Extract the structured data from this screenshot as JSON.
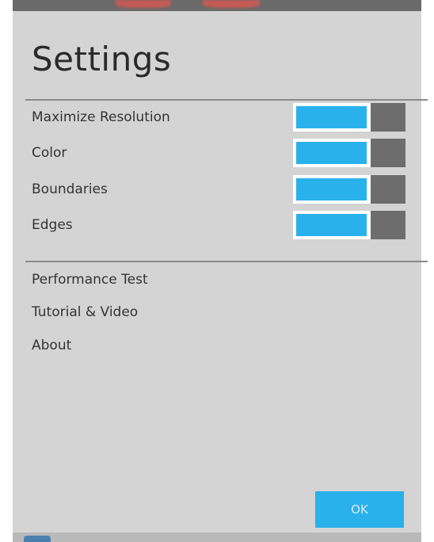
{
  "dialog": {
    "title": "Settings"
  },
  "toggles": [
    {
      "label": "Maximize Resolution",
      "on": true
    },
    {
      "label": "Color",
      "on": true
    },
    {
      "label": "Boundaries",
      "on": true
    },
    {
      "label": "Edges",
      "on": true
    }
  ],
  "menu": [
    {
      "label": "Performance Test"
    },
    {
      "label": "Tutorial & Video"
    },
    {
      "label": "About"
    }
  ],
  "buttons": {
    "ok_label": "OK"
  },
  "colors": {
    "panel_background": "#d4d4d4",
    "accent": "#29b1ec",
    "toggle_thumb": "#6d6d6d",
    "divider": "#8a8a8a",
    "text": "#333333"
  }
}
